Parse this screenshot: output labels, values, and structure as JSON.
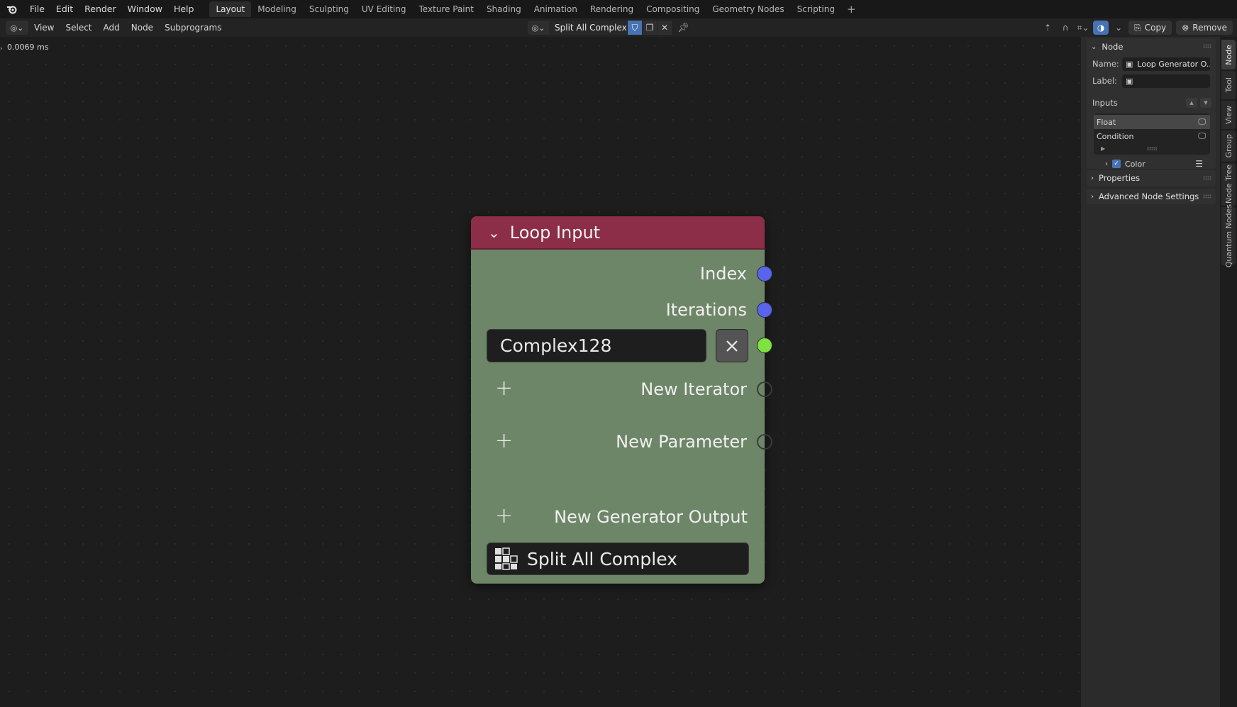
{
  "topbar": {
    "menus": [
      "File",
      "Edit",
      "Render",
      "Window",
      "Help"
    ],
    "workspaces": [
      "Layout",
      "Modeling",
      "Sculpting",
      "UV Editing",
      "Texture Paint",
      "Shading",
      "Animation",
      "Rendering",
      "Compositing",
      "Geometry Nodes",
      "Scripting"
    ],
    "active_workspace": "Layout",
    "add_tab": "+"
  },
  "header": {
    "menus": [
      "View",
      "Select",
      "Add",
      "Node",
      "Subprograms"
    ],
    "node_tree_name": "Split All Complex",
    "copy_label": "Copy",
    "remove_label": "Remove"
  },
  "canvas": {
    "timing": "0.0069 ms"
  },
  "node": {
    "title": "Loop Input",
    "outputs": {
      "index": "Index",
      "iterations": "Iterations",
      "new_iterator": "New Iterator",
      "new_parameter": "New Parameter",
      "new_generator_output": "New Generator Output"
    },
    "data_type_value": "Complex128",
    "subprogram": "Split All Complex",
    "colors": {
      "header": "#8c2e47",
      "body": "#6d8667",
      "socket_int": "#5a63ee",
      "socket_data": "#7ee23f"
    }
  },
  "sidebar": {
    "node_panel": {
      "title": "Node",
      "name_label": "Name:",
      "name_value": "Loop Generator O...",
      "label_label": "Label:",
      "label_value": "",
      "inputs_label": "Inputs",
      "inputs": [
        {
          "name": "Float",
          "selected": true
        },
        {
          "name": "Condition",
          "selected": false
        }
      ],
      "color_label": "Color",
      "color_checked": true
    },
    "properties_label": "Properties",
    "advanced_label": "Advanced Node Settings",
    "tabs": [
      "Node",
      "Tool",
      "View",
      "Group",
      "Node Tree",
      "Quantum Nodes"
    ],
    "active_tab": "Node"
  }
}
